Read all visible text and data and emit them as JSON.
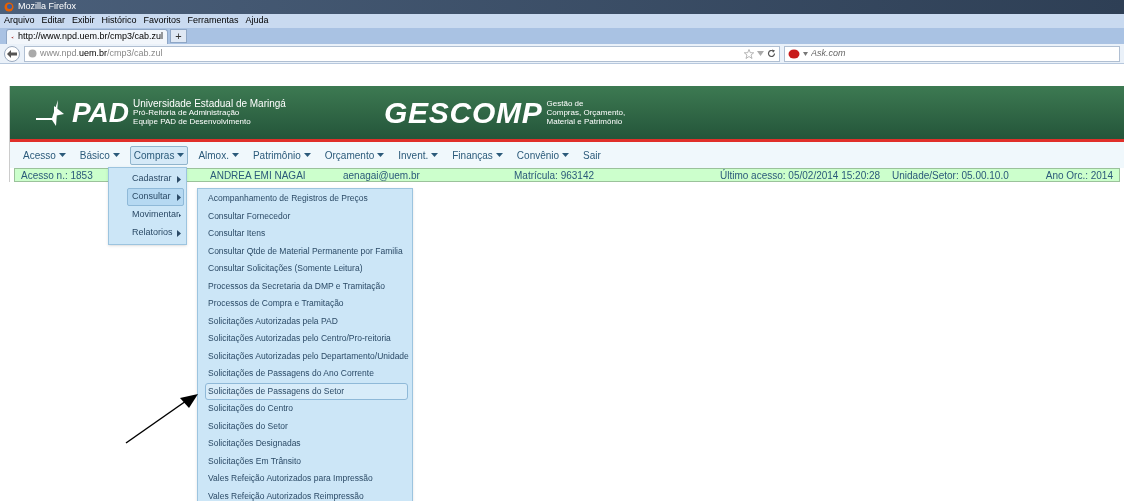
{
  "window": {
    "title": "Mozilla Firefox"
  },
  "menu_bar": [
    "Arquivo",
    "Editar",
    "Exibir",
    "Histórico",
    "Favoritos",
    "Ferramentas",
    "Ajuda"
  ],
  "tab": {
    "title": "http://www.npd.uem.br/cmp3/cab.zul",
    "new_tab_label": "+"
  },
  "address_bar": {
    "url_host": "www.npd.",
    "url_domain": "uem.br",
    "url_path": "/cmp3/cab.zul"
  },
  "search_bar": {
    "placeholder": "Ask.com"
  },
  "banner": {
    "logo": "PAD",
    "org_lines": [
      "Universidade Estadual de Maringá",
      "Pró-Reitoria de Administração",
      "Equipe PAD de Desenvolvimento"
    ],
    "app_name": "GESCOMP",
    "app_lines": [
      "Gestão de",
      "Compras, Orçamento,",
      "Material e Patrimônio"
    ]
  },
  "app_menu": [
    {
      "label": "Acesso",
      "has_dropdown": true,
      "selected": false
    },
    {
      "label": "Básico",
      "has_dropdown": true,
      "selected": false
    },
    {
      "label": "Compras",
      "has_dropdown": true,
      "selected": true
    },
    {
      "label": "Almox.",
      "has_dropdown": true,
      "selected": false
    },
    {
      "label": "Patrimônio",
      "has_dropdown": true,
      "selected": false
    },
    {
      "label": "Orçamento",
      "has_dropdown": true,
      "selected": false
    },
    {
      "label": "Invent.",
      "has_dropdown": true,
      "selected": false
    },
    {
      "label": "Finanças",
      "has_dropdown": true,
      "selected": false
    },
    {
      "label": "Convênio",
      "has_dropdown": true,
      "selected": false
    },
    {
      "label": "Sair",
      "has_dropdown": false,
      "selected": false
    }
  ],
  "info_bar": [
    "Acesso n.: 1853",
    "ANDREA EMI NAGAI",
    "aenagai@uem.br",
    "Matrícula: 963142",
    "Último acesso: 05/02/2014 15:20:28",
    "Unidade/Setor: 05.00.10.0",
    "Ano Orc.: 2014"
  ],
  "compras_menu": [
    {
      "label": "Cadastrar",
      "selected": false
    },
    {
      "label": "Consultar",
      "selected": true
    },
    {
      "label": "Movimentar",
      "selected": false
    },
    {
      "label": "Relatorios",
      "selected": false
    }
  ],
  "consultar_menu": [
    {
      "label": "Acompanhamento de Registros de Preços",
      "selected": false
    },
    {
      "label": "Consultar Fornecedor",
      "selected": false
    },
    {
      "label": "Consultar Itens",
      "selected": false
    },
    {
      "label": "Consultar Qtde de Material Permanente por Familia",
      "selected": false
    },
    {
      "label": "Consultar Solicitações (Somente Leitura)",
      "selected": false
    },
    {
      "label": "Processos da Secretaria da DMP e Tramitação",
      "selected": false
    },
    {
      "label": "Processos de Compra e Tramitação",
      "selected": false
    },
    {
      "label": "Solicitações Autorizadas pela PAD",
      "selected": false
    },
    {
      "label": "Solicitações Autorizadas pelo Centro/Pro-reitoria",
      "selected": false
    },
    {
      "label": "Solicitações Autorizadas pelo Departamento/Unidade",
      "selected": false
    },
    {
      "label": "Solicitações de Passagens do Ano Corrente",
      "selected": false
    },
    {
      "label": "Solicitações de Passagens do Setor",
      "selected": true
    },
    {
      "label": "Solicitações do Centro",
      "selected": false
    },
    {
      "label": "Solicitações do Setor",
      "selected": false
    },
    {
      "label": "Solicitações Designadas",
      "selected": false
    },
    {
      "label": "Solicitações Em Trânsito",
      "selected": false
    },
    {
      "label": "Vales Refeição Autorizados para Impressão",
      "selected": false
    },
    {
      "label": "Vales Refeição Autorizados Reimpressão",
      "selected": false
    }
  ]
}
